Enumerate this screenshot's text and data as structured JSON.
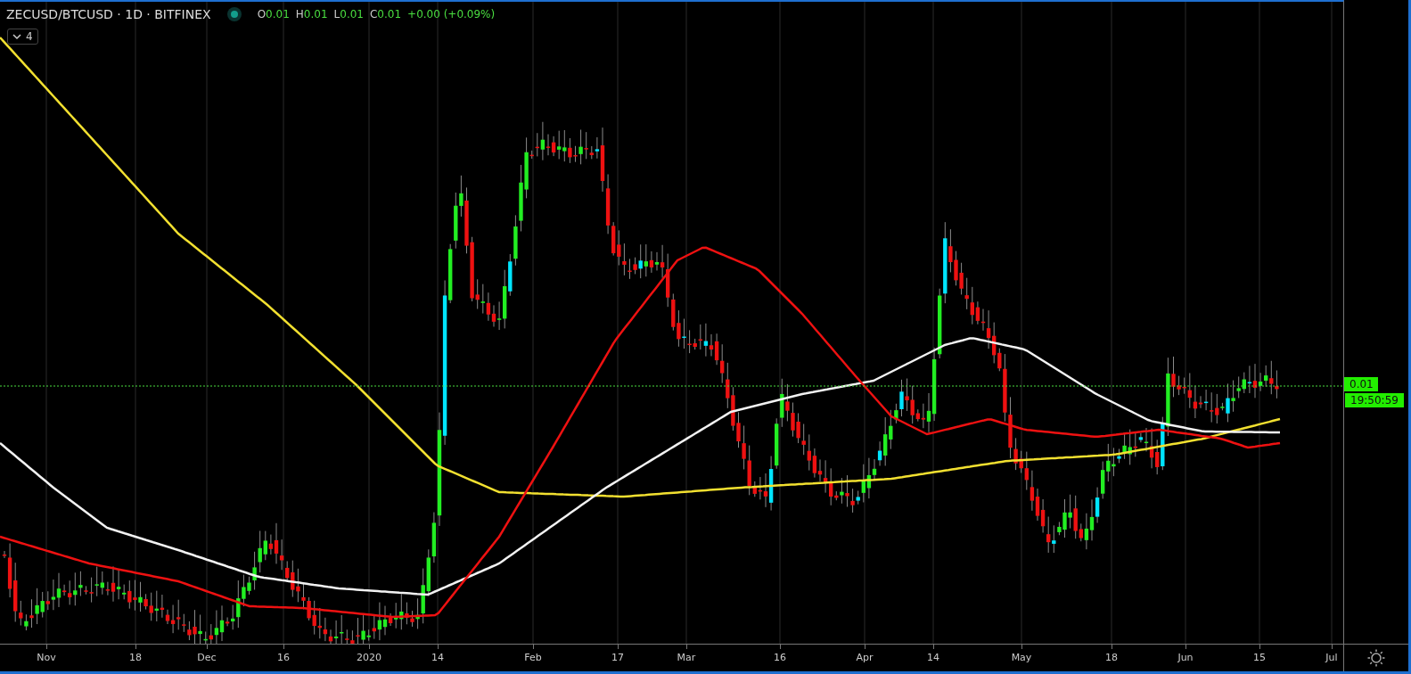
{
  "header": {
    "symbol": "ZECUSD/BTCUSD · 1D · BITFINEX",
    "ohlc": [
      {
        "label": "O",
        "value": "0.01"
      },
      {
        "label": "H",
        "value": "0.01"
      },
      {
        "label": "L",
        "value": "0.01"
      },
      {
        "label": "C",
        "value": "0.01"
      }
    ],
    "change": "+0.00 (+0.09%)"
  },
  "indicators_toggle": {
    "count": "4"
  },
  "price_axis": {
    "last_price": "0.01",
    "countdown": "19:50:59"
  },
  "time_axis": {
    "labels": [
      "Nov",
      "18",
      "Dec",
      "16",
      "2020",
      "14",
      "Feb",
      "17",
      "Mar",
      "16",
      "Apr",
      "14",
      "May",
      "18",
      "Jun",
      "15",
      "Jul"
    ]
  }
}
